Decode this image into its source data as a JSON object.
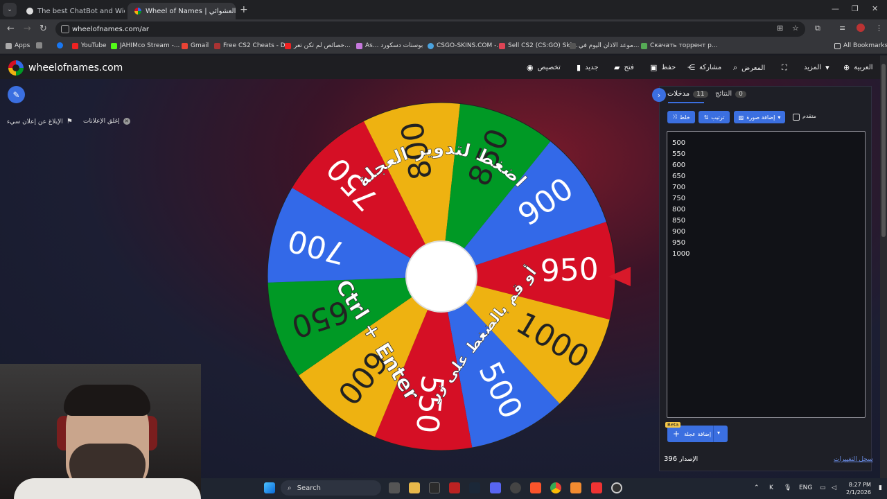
{
  "browser": {
    "tabs": [
      {
        "title": "The best ChatBot and Widgets",
        "active": false
      },
      {
        "title": "Wheel of Names | سم العشوائي",
        "active": true
      }
    ],
    "url": "wheelofnames.com/ar",
    "bookmarks": [
      "Apps",
      "YouTube",
      "JAHIMco Stream -...",
      "Gmail",
      "Free CS2 Cheats - D...",
      "خصائص لم تكن تعر...",
      "As... بوستات دسكورد",
      "CSGO-SKINS.COM -...",
      "Sell CS2 (CS:GO) Ski...",
      "موعد الاذان اليوم في...",
      "Скачать торрент р...",
      "All Bookmarks"
    ]
  },
  "header": {
    "brand": "wheelofnames.com",
    "menu": [
      {
        "label": "تخصيص",
        "icon": "palette-icon"
      },
      {
        "label": "جديد",
        "icon": "file-icon"
      },
      {
        "label": "فتح",
        "icon": "folder-icon"
      },
      {
        "label": "حفظ",
        "icon": "save-icon"
      },
      {
        "label": "مشاركة",
        "icon": "share-icon"
      },
      {
        "label": "المعرض",
        "icon": "search-icon"
      },
      {
        "label": "المزيد",
        "icon": "chevron-down-icon"
      },
      {
        "label": "العربية",
        "icon": "globe-icon"
      }
    ]
  },
  "sidebar_left": {
    "report_ad": "الإبلاغ عن إعلان سيء",
    "close_ads": "إغلق الإعلانات"
  },
  "wheel": {
    "instructions_top": "اضغط لتدوير العجلة",
    "instructions_bottom": "أو قم بالضغط على زر",
    "shortcut": "Ctrl + Enter",
    "segments": [
      "500",
      "550",
      "600",
      "650",
      "700",
      "750",
      "800",
      "850",
      "900",
      "950",
      "1000"
    ],
    "colors": [
      "#3369e8",
      "#d50f25",
      "#eeb211",
      "#009925"
    ]
  },
  "panel": {
    "tab_entries": "مدخلات",
    "tab_entries_count": "11",
    "tab_results": "النتائج",
    "tab_results_count": "0",
    "btn_shuffle": "خلط",
    "btn_sort": "ترتيب",
    "btn_add_image": "إضافة صورة",
    "advanced_label": "متقدم",
    "entries": [
      "500",
      "550",
      "600",
      "650",
      "700",
      "750",
      "800",
      "850",
      "900",
      "950",
      "1000"
    ],
    "add_wheel": "إضافة عجلة",
    "beta": "Beta",
    "version_label": "الإصدار",
    "version_number": "396",
    "changelog": "سجل التغييرات"
  },
  "taskbar": {
    "search_placeholder": "Search",
    "lang": "ENG",
    "time": "8:27 PM",
    "date": "2/1/2026"
  }
}
